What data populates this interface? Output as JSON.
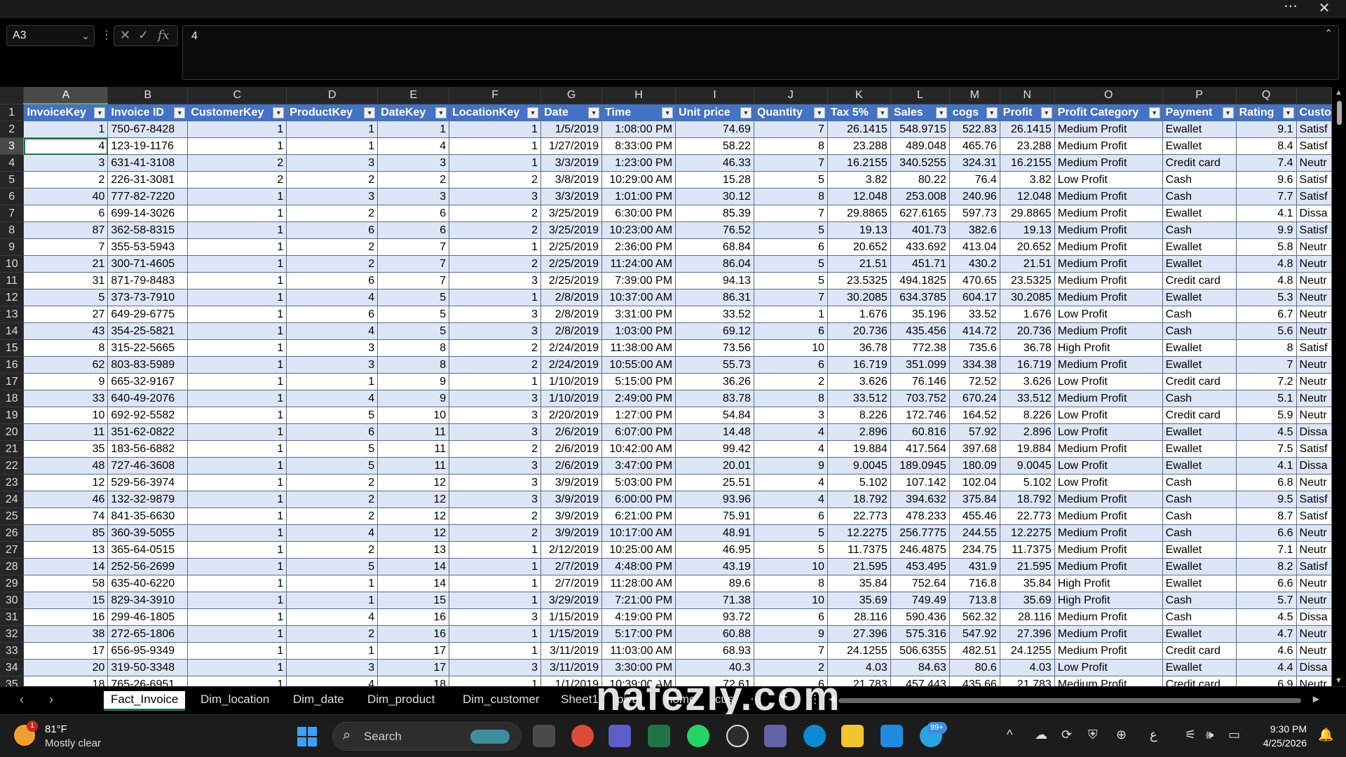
{
  "titlebar": {
    "more_icon": "⋯",
    "close_icon": "✕"
  },
  "formula_bar": {
    "name_box": "A3",
    "name_box_chevron": "⌄",
    "more_icon": "⋮",
    "cancel_icon": "✕",
    "enter_icon": "✓",
    "fx_icon": "fx",
    "value": "4",
    "collapse_icon": "⌃"
  },
  "grid": {
    "active_cell": "A3",
    "columns": [
      {
        "letter": "A",
        "header": "InvoiceKey",
        "align": "num"
      },
      {
        "letter": "B",
        "header": "Invoice ID",
        "align": "txt"
      },
      {
        "letter": "C",
        "header": "CustomerKey",
        "align": "num"
      },
      {
        "letter": "D",
        "header": "ProductKey",
        "align": "num"
      },
      {
        "letter": "E",
        "header": "DateKey",
        "align": "num"
      },
      {
        "letter": "F",
        "header": "LocationKey",
        "align": "num"
      },
      {
        "letter": "G",
        "header": "Date",
        "align": "num"
      },
      {
        "letter": "H",
        "header": "Time",
        "align": "num"
      },
      {
        "letter": "I",
        "header": "Unit price",
        "align": "num"
      },
      {
        "letter": "J",
        "header": "Quantity",
        "align": "num"
      },
      {
        "letter": "K",
        "header": "Tax 5%",
        "align": "num"
      },
      {
        "letter": "L",
        "header": "Sales",
        "align": "num"
      },
      {
        "letter": "M",
        "header": "cogs",
        "align": "num"
      },
      {
        "letter": "N",
        "header": "Profit",
        "align": "num"
      },
      {
        "letter": "O",
        "header": "Profit Category",
        "align": "txt"
      },
      {
        "letter": "P",
        "header": "Payment",
        "align": "txt"
      },
      {
        "letter": "Q",
        "header": "Rating",
        "align": "num"
      },
      {
        "letter": "",
        "header": "Custo",
        "align": "txt"
      }
    ],
    "rows": [
      {
        "n": "2",
        "cells": [
          "1",
          "750-67-8428",
          "1",
          "1",
          "1",
          "1",
          "1/5/2019",
          "1:08:00 PM",
          "74.69",
          "7",
          "26.1415",
          "548.9715",
          "522.83",
          "26.1415",
          "Medium Profit",
          "Ewallet",
          "9.1",
          "Satisf"
        ]
      },
      {
        "n": "3",
        "cells": [
          "4",
          "123-19-1176",
          "1",
          "1",
          "4",
          "1",
          "1/27/2019",
          "8:33:00 PM",
          "58.22",
          "8",
          "23.288",
          "489.048",
          "465.76",
          "23.288",
          "Medium Profit",
          "Ewallet",
          "8.4",
          "Satisf"
        ]
      },
      {
        "n": "4",
        "cells": [
          "3",
          "631-41-3108",
          "2",
          "3",
          "3",
          "1",
          "3/3/2019",
          "1:23:00 PM",
          "46.33",
          "7",
          "16.2155",
          "340.5255",
          "324.31",
          "16.2155",
          "Medium Profit",
          "Credit card",
          "7.4",
          "Neutr"
        ]
      },
      {
        "n": "5",
        "cells": [
          "2",
          "226-31-3081",
          "2",
          "2",
          "2",
          "2",
          "3/8/2019",
          "10:29:00 AM",
          "15.28",
          "5",
          "3.82",
          "80.22",
          "76.4",
          "3.82",
          "Low Profit",
          "Cash",
          "9.6",
          "Satisf"
        ]
      },
      {
        "n": "6",
        "cells": [
          "40",
          "777-82-7220",
          "1",
          "3",
          "3",
          "3",
          "3/3/2019",
          "1:01:00 PM",
          "30.12",
          "8",
          "12.048",
          "253.008",
          "240.96",
          "12.048",
          "Medium Profit",
          "Cash",
          "7.7",
          "Satisf"
        ]
      },
      {
        "n": "7",
        "cells": [
          "6",
          "699-14-3026",
          "1",
          "2",
          "6",
          "2",
          "3/25/2019",
          "6:30:00 PM",
          "85.39",
          "7",
          "29.8865",
          "627.6165",
          "597.73",
          "29.8865",
          "Medium Profit",
          "Ewallet",
          "4.1",
          "Dissa"
        ]
      },
      {
        "n": "8",
        "cells": [
          "87",
          "362-58-8315",
          "1",
          "6",
          "6",
          "2",
          "3/25/2019",
          "10:23:00 AM",
          "76.52",
          "5",
          "19.13",
          "401.73",
          "382.6",
          "19.13",
          "Medium Profit",
          "Cash",
          "9.9",
          "Satisf"
        ]
      },
      {
        "n": "9",
        "cells": [
          "7",
          "355-53-5943",
          "1",
          "2",
          "7",
          "1",
          "2/25/2019",
          "2:36:00 PM",
          "68.84",
          "6",
          "20.652",
          "433.692",
          "413.04",
          "20.652",
          "Medium Profit",
          "Ewallet",
          "5.8",
          "Neutr"
        ]
      },
      {
        "n": "10",
        "cells": [
          "21",
          "300-71-4605",
          "1",
          "2",
          "7",
          "2",
          "2/25/2019",
          "11:24:00 AM",
          "86.04",
          "5",
          "21.51",
          "451.71",
          "430.2",
          "21.51",
          "Medium Profit",
          "Ewallet",
          "4.8",
          "Neutr"
        ]
      },
      {
        "n": "11",
        "cells": [
          "31",
          "871-79-8483",
          "1",
          "6",
          "7",
          "3",
          "2/25/2019",
          "7:39:00 PM",
          "94.13",
          "5",
          "23.5325",
          "494.1825",
          "470.65",
          "23.5325",
          "Medium Profit",
          "Credit card",
          "4.8",
          "Neutr"
        ]
      },
      {
        "n": "12",
        "cells": [
          "5",
          "373-73-7910",
          "1",
          "4",
          "5",
          "1",
          "2/8/2019",
          "10:37:00 AM",
          "86.31",
          "7",
          "30.2085",
          "634.3785",
          "604.17",
          "30.2085",
          "Medium Profit",
          "Ewallet",
          "5.3",
          "Neutr"
        ]
      },
      {
        "n": "13",
        "cells": [
          "27",
          "649-29-6775",
          "1",
          "6",
          "5",
          "3",
          "2/8/2019",
          "3:31:00 PM",
          "33.52",
          "1",
          "1.676",
          "35.196",
          "33.52",
          "1.676",
          "Low Profit",
          "Cash",
          "6.7",
          "Neutr"
        ]
      },
      {
        "n": "14",
        "cells": [
          "43",
          "354-25-5821",
          "1",
          "4",
          "5",
          "3",
          "2/8/2019",
          "1:03:00 PM",
          "69.12",
          "6",
          "20.736",
          "435.456",
          "414.72",
          "20.736",
          "Medium Profit",
          "Cash",
          "5.6",
          "Neutr"
        ]
      },
      {
        "n": "15",
        "cells": [
          "8",
          "315-22-5665",
          "1",
          "3",
          "8",
          "2",
          "2/24/2019",
          "11:38:00 AM",
          "73.56",
          "10",
          "36.78",
          "772.38",
          "735.6",
          "36.78",
          "High Profit",
          "Ewallet",
          "8",
          "Satisf"
        ]
      },
      {
        "n": "16",
        "cells": [
          "62",
          "803-83-5989",
          "1",
          "3",
          "8",
          "2",
          "2/24/2019",
          "10:55:00 AM",
          "55.73",
          "6",
          "16.719",
          "351.099",
          "334.38",
          "16.719",
          "Medium Profit",
          "Ewallet",
          "7",
          "Neutr"
        ]
      },
      {
        "n": "17",
        "cells": [
          "9",
          "665-32-9167",
          "1",
          "1",
          "9",
          "1",
          "1/10/2019",
          "5:15:00 PM",
          "36.26",
          "2",
          "3.626",
          "76.146",
          "72.52",
          "3.626",
          "Low Profit",
          "Credit card",
          "7.2",
          "Neutr"
        ]
      },
      {
        "n": "18",
        "cells": [
          "33",
          "640-49-2076",
          "1",
          "4",
          "9",
          "3",
          "1/10/2019",
          "2:49:00 PM",
          "83.78",
          "8",
          "33.512",
          "703.752",
          "670.24",
          "33.512",
          "Medium Profit",
          "Cash",
          "5.1",
          "Neutr"
        ]
      },
      {
        "n": "19",
        "cells": [
          "10",
          "692-92-5582",
          "1",
          "5",
          "10",
          "3",
          "2/20/2019",
          "1:27:00 PM",
          "54.84",
          "3",
          "8.226",
          "172.746",
          "164.52",
          "8.226",
          "Low Profit",
          "Credit card",
          "5.9",
          "Neutr"
        ]
      },
      {
        "n": "20",
        "cells": [
          "11",
          "351-62-0822",
          "1",
          "6",
          "11",
          "3",
          "2/6/2019",
          "6:07:00 PM",
          "14.48",
          "4",
          "2.896",
          "60.816",
          "57.92",
          "2.896",
          "Low Profit",
          "Ewallet",
          "4.5",
          "Dissa"
        ]
      },
      {
        "n": "21",
        "cells": [
          "35",
          "183-56-6882",
          "1",
          "5",
          "11",
          "2",
          "2/6/2019",
          "10:42:00 AM",
          "99.42",
          "4",
          "19.884",
          "417.564",
          "397.68",
          "19.884",
          "Medium Profit",
          "Ewallet",
          "7.5",
          "Satisf"
        ]
      },
      {
        "n": "22",
        "cells": [
          "48",
          "727-46-3608",
          "1",
          "5",
          "11",
          "3",
          "2/6/2019",
          "3:47:00 PM",
          "20.01",
          "9",
          "9.0045",
          "189.0945",
          "180.09",
          "9.0045",
          "Low Profit",
          "Ewallet",
          "4.1",
          "Dissa"
        ]
      },
      {
        "n": "23",
        "cells": [
          "12",
          "529-56-3974",
          "1",
          "2",
          "12",
          "3",
          "3/9/2019",
          "5:03:00 PM",
          "25.51",
          "4",
          "5.102",
          "107.142",
          "102.04",
          "5.102",
          "Low Profit",
          "Cash",
          "6.8",
          "Neutr"
        ]
      },
      {
        "n": "24",
        "cells": [
          "46",
          "132-32-9879",
          "1",
          "2",
          "12",
          "3",
          "3/9/2019",
          "6:00:00 PM",
          "93.96",
          "4",
          "18.792",
          "394.632",
          "375.84",
          "18.792",
          "Medium Profit",
          "Cash",
          "9.5",
          "Satisf"
        ]
      },
      {
        "n": "25",
        "cells": [
          "74",
          "841-35-6630",
          "1",
          "2",
          "12",
          "2",
          "3/9/2019",
          "6:21:00 PM",
          "75.91",
          "6",
          "22.773",
          "478.233",
          "455.46",
          "22.773",
          "Medium Profit",
          "Cash",
          "8.7",
          "Satisf"
        ]
      },
      {
        "n": "26",
        "cells": [
          "85",
          "360-39-5055",
          "1",
          "4",
          "12",
          "2",
          "3/9/2019",
          "10:17:00 AM",
          "48.91",
          "5",
          "12.2275",
          "256.7775",
          "244.55",
          "12.2275",
          "Medium Profit",
          "Cash",
          "6.6",
          "Neutr"
        ]
      },
      {
        "n": "27",
        "cells": [
          "13",
          "365-64-0515",
          "1",
          "2",
          "13",
          "1",
          "2/12/2019",
          "10:25:00 AM",
          "46.95",
          "5",
          "11.7375",
          "246.4875",
          "234.75",
          "11.7375",
          "Medium Profit",
          "Ewallet",
          "7.1",
          "Neutr"
        ]
      },
      {
        "n": "28",
        "cells": [
          "14",
          "252-56-2699",
          "1",
          "5",
          "14",
          "1",
          "2/7/2019",
          "4:48:00 PM",
          "43.19",
          "10",
          "21.595",
          "453.495",
          "431.9",
          "21.595",
          "Medium Profit",
          "Ewallet",
          "8.2",
          "Satisf"
        ]
      },
      {
        "n": "29",
        "cells": [
          "58",
          "635-40-6220",
          "1",
          "1",
          "14",
          "1",
          "2/7/2019",
          "11:28:00 AM",
          "89.6",
          "8",
          "35.84",
          "752.64",
          "716.8",
          "35.84",
          "High Profit",
          "Ewallet",
          "6.6",
          "Neutr"
        ]
      },
      {
        "n": "30",
        "cells": [
          "15",
          "829-34-3910",
          "1",
          "1",
          "15",
          "1",
          "3/29/2019",
          "7:21:00 PM",
          "71.38",
          "10",
          "35.69",
          "749.49",
          "713.8",
          "35.69",
          "High Profit",
          "Cash",
          "5.7",
          "Neutr"
        ]
      },
      {
        "n": "31",
        "cells": [
          "16",
          "299-46-1805",
          "1",
          "4",
          "16",
          "3",
          "1/15/2019",
          "4:19:00 PM",
          "93.72",
          "6",
          "28.116",
          "590.436",
          "562.32",
          "28.116",
          "Medium Profit",
          "Cash",
          "4.5",
          "Dissa"
        ]
      },
      {
        "n": "32",
        "cells": [
          "38",
          "272-65-1806",
          "1",
          "2",
          "16",
          "1",
          "1/15/2019",
          "5:17:00 PM",
          "60.88",
          "9",
          "27.396",
          "575.316",
          "547.92",
          "27.396",
          "Medium Profit",
          "Ewallet",
          "4.7",
          "Neutr"
        ]
      },
      {
        "n": "33",
        "cells": [
          "17",
          "656-95-9349",
          "1",
          "1",
          "17",
          "1",
          "3/11/2019",
          "11:03:00 AM",
          "68.93",
          "7",
          "24.1255",
          "506.6355",
          "482.51",
          "24.1255",
          "Medium Profit",
          "Credit card",
          "4.6",
          "Neutr"
        ]
      },
      {
        "n": "34",
        "cells": [
          "20",
          "319-50-3348",
          "1",
          "3",
          "17",
          "3",
          "3/11/2019",
          "3:30:00 PM",
          "40.3",
          "2",
          "4.03",
          "84.63",
          "80.6",
          "4.03",
          "Low Profit",
          "Ewallet",
          "4.4",
          "Dissa"
        ]
      },
      {
        "n": "35",
        "cells": [
          "18",
          "765-26-6951",
          "1",
          "4",
          "18",
          "1",
          "1/1/2019",
          "10:39:00 AM",
          "72.61",
          "6",
          "21.783",
          "457.443",
          "435.66",
          "21.783",
          "Medium Profit",
          "Credit card",
          "6.9",
          "Neutr"
        ]
      }
    ]
  },
  "sheet_tabs": {
    "prev_icon": "‹",
    "next_icon": "›",
    "tabs": [
      "Fact_Invoice",
      "Dim_location",
      "Dim_date",
      "Dim_product",
      "Dim_customer",
      "Sheet1",
      "pivot",
      "home",
      "cus"
    ],
    "active": "Fact_Invoice",
    "overflow_icon": "⋯",
    "add_icon": "+",
    "options_icon": "⋮"
  },
  "watermark": "nafezly.com",
  "taskbar": {
    "weather": {
      "badge": "1",
      "temp": "81°F",
      "condition": "Mostly clear"
    },
    "search_label": "Search",
    "search_icon": "⌕",
    "apps": [
      "task-view-icon",
      "chrome-icon",
      "teams-icon",
      "excel-icon",
      "whatsapp-icon",
      "chatgpt-icon",
      "teams-chat-icon",
      "edge-icon",
      "file-explorer-icon",
      "photos-icon",
      "telegram-icon"
    ],
    "telegram_badge": "99+",
    "tray_chevron": "^",
    "language": "ع",
    "time": "9:30 PM",
    "date": "4/25/2026",
    "colors": {
      "taskbar_bg": "#1c1c1c",
      "excel_green": "#217346",
      "header_blue": "#4472c4",
      "band_blue": "#dce6f6"
    }
  }
}
